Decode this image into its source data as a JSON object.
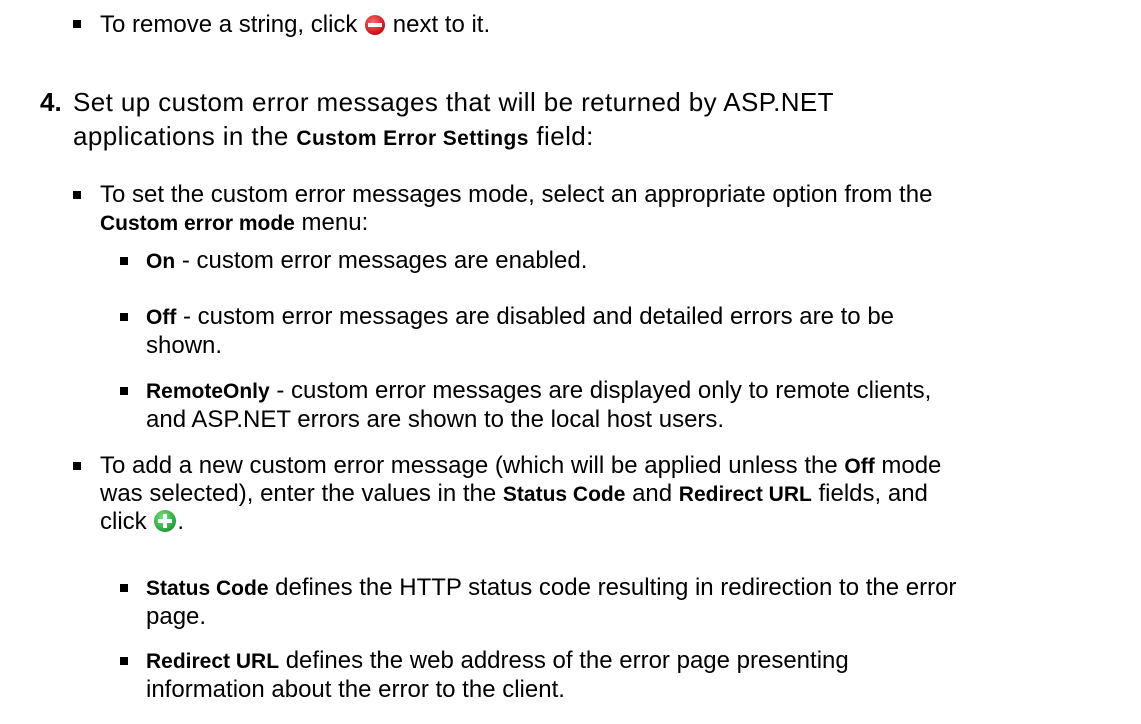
{
  "intro": {
    "remove": {
      "before": "To remove a string, click ",
      "icon": "remove-icon",
      "after": " next to it."
    }
  },
  "step4": {
    "number": "4.",
    "line1": "Set up custom error messages that will be returned by ASP.NET",
    "line2_pre": "applications in the ",
    "line2_bold": "Custom Error Settings",
    "line2_post": " field:"
  },
  "mode": {
    "line1": "To set the custom error messages mode, select an appropriate option from the",
    "line2_bold": "Custom error mode",
    "line2_post": " menu:",
    "options": {
      "on": {
        "term": "On",
        "desc": " - custom error messages are enabled."
      },
      "off": {
        "term": "Off",
        "desc": " - custom error messages are disabled and detailed errors are to be",
        "desc2": "shown."
      },
      "remote": {
        "term": "RemoteOnly",
        "desc": " - custom error messages are displayed only to remote clients,",
        "desc2": "and ASP.NET errors are shown to the local host users."
      }
    }
  },
  "add": {
    "l1_pre": "To add a new custom error message (which will be applied unless the ",
    "l1_bold": "Off",
    "l1_post": " mode",
    "l2_pre": "was selected), enter the values in the ",
    "l2_bold1": "Status Code",
    "l2_mid": " and ",
    "l2_bold2": "Redirect URL",
    "l2_post": " fields, and",
    "l3_pre": "click ",
    "l3_icon": "add-icon",
    "l3_post": ".",
    "items": {
      "status": {
        "term": "Status Code",
        "desc": " defines the HTTP status code resulting in redirection to the error",
        "desc2": "page."
      },
      "redirect": {
        "term": "Redirect URL",
        "desc": " defines the web address of the error page presenting",
        "desc2": "information about the error to the client."
      }
    }
  },
  "colors": {
    "remove_icon": "#e8101a",
    "add_icon": "#2fb84a"
  }
}
